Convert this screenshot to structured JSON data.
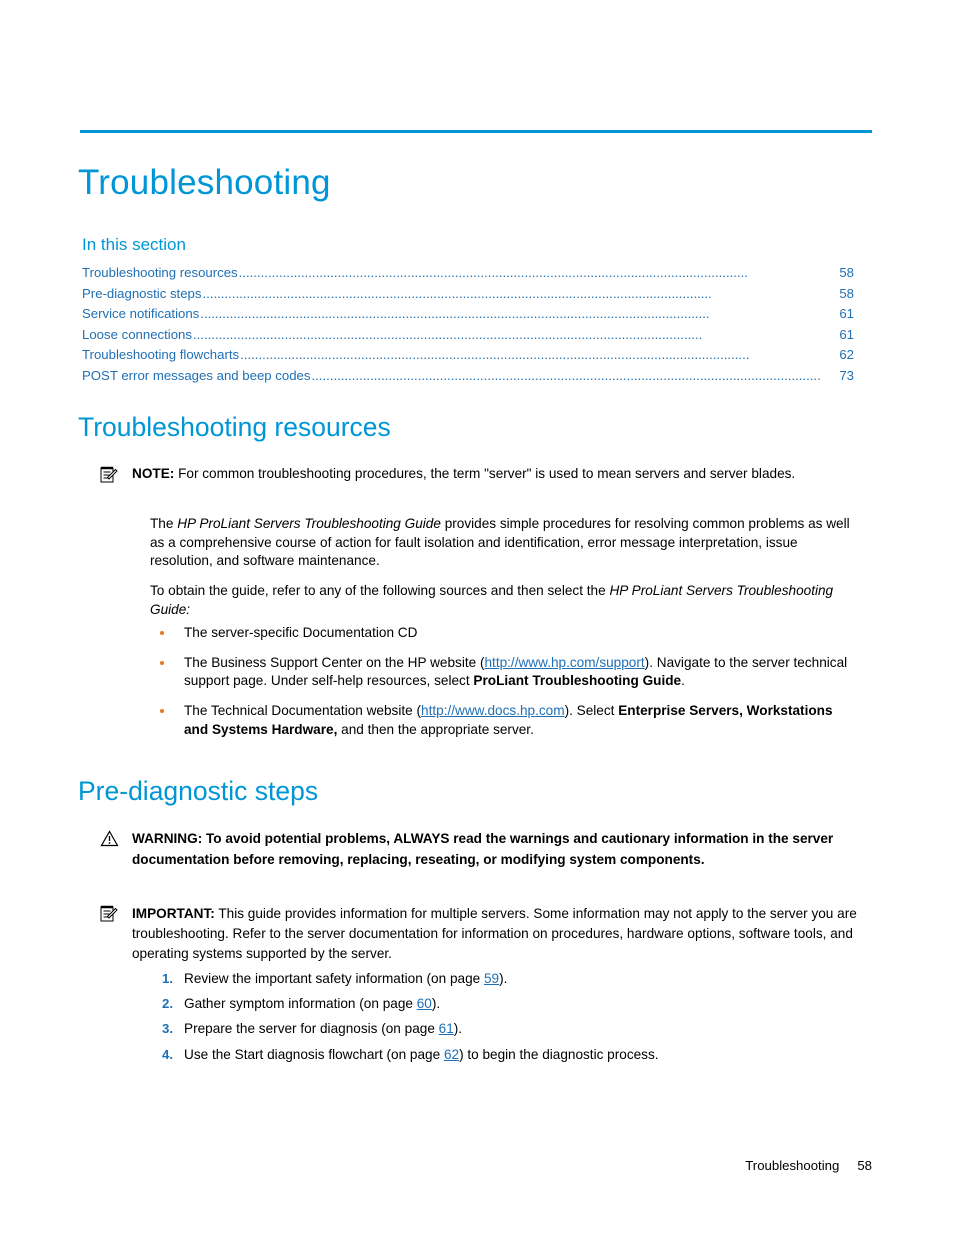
{
  "page": {
    "title": "Troubleshooting",
    "footer_label": "Troubleshooting",
    "footer_page": "58"
  },
  "toc": {
    "heading": "In this section",
    "entries": [
      {
        "label": "Troubleshooting resources",
        "page": "58"
      },
      {
        "label": "Pre-diagnostic steps",
        "page": "58"
      },
      {
        "label": "Service notifications",
        "page": "61"
      },
      {
        "label": "Loose connections",
        "page": "61"
      },
      {
        "label": "Troubleshooting flowcharts",
        "page": "62"
      },
      {
        "label": "POST error messages and beep codes",
        "page": "73"
      }
    ]
  },
  "sections": {
    "resources": {
      "heading": "Troubleshooting resources",
      "note_label": "NOTE:",
      "note_text": "For common troubleshooting procedures, the term \"server\" is used to mean servers and server blades.",
      "para1_pre": "The ",
      "para1_italic": "HP ProLiant Servers Troubleshooting Guide",
      "para1_post": " provides simple procedures for resolving common problems as well as a comprehensive course of action for fault isolation and identification, error message interpretation, issue resolution, and software maintenance.",
      "para2_pre": "To obtain the guide, refer to any of the following sources and then select the ",
      "para2_italic": "HP ProLiant Servers Troubleshooting Guide:",
      "bullets": [
        {
          "text_1": "The server-specific Documentation CD"
        },
        {
          "text_1": "The Business Support Center on the HP website (",
          "link": "http://www.hp.com/support",
          "text_2": "). Navigate to the server technical support page. Under self-help resources, select ",
          "bold_1": "ProLiant Troubleshooting Guide",
          "text_3": "."
        },
        {
          "text_1": "The Technical Documentation website (",
          "link": "http://www.docs.hp.com",
          "text_2": "). Select ",
          "bold_1": "Enterprise Servers, Workstations and Systems Hardware,",
          "text_3": " and then the appropriate server."
        }
      ]
    },
    "prediagnostic": {
      "heading": "Pre-diagnostic steps",
      "warning_label": "WARNING:",
      "warning_text": "To avoid potential problems, ALWAYS read the warnings and cautionary information in the server documentation before removing, replacing, reseating, or modifying system components.",
      "important_label": "IMPORTANT:",
      "important_text": "This guide provides information for multiple servers. Some information may not apply to the server you are troubleshooting. Refer to the server documentation for information on procedures, hardware options, software tools, and operating systems supported by the server.",
      "steps": [
        {
          "num": "1.",
          "text_1": "Review the important safety information (on page ",
          "page": "59",
          "text_2": ")."
        },
        {
          "num": "2.",
          "text_1": "Gather symptom information (on page ",
          "page": "60",
          "text_2": ")."
        },
        {
          "num": "3.",
          "text_1": "Prepare the server for diagnosis (on page ",
          "page": "61",
          "text_2": ")."
        },
        {
          "num": "4.",
          "text_1": "Use the Start diagnosis flowchart (on page ",
          "page": "62",
          "text_2": ") to begin the diagnostic process."
        }
      ]
    }
  },
  "colors": {
    "accent": "#0096d6",
    "link": "#1f6fb5",
    "bullet": "#e87722"
  }
}
